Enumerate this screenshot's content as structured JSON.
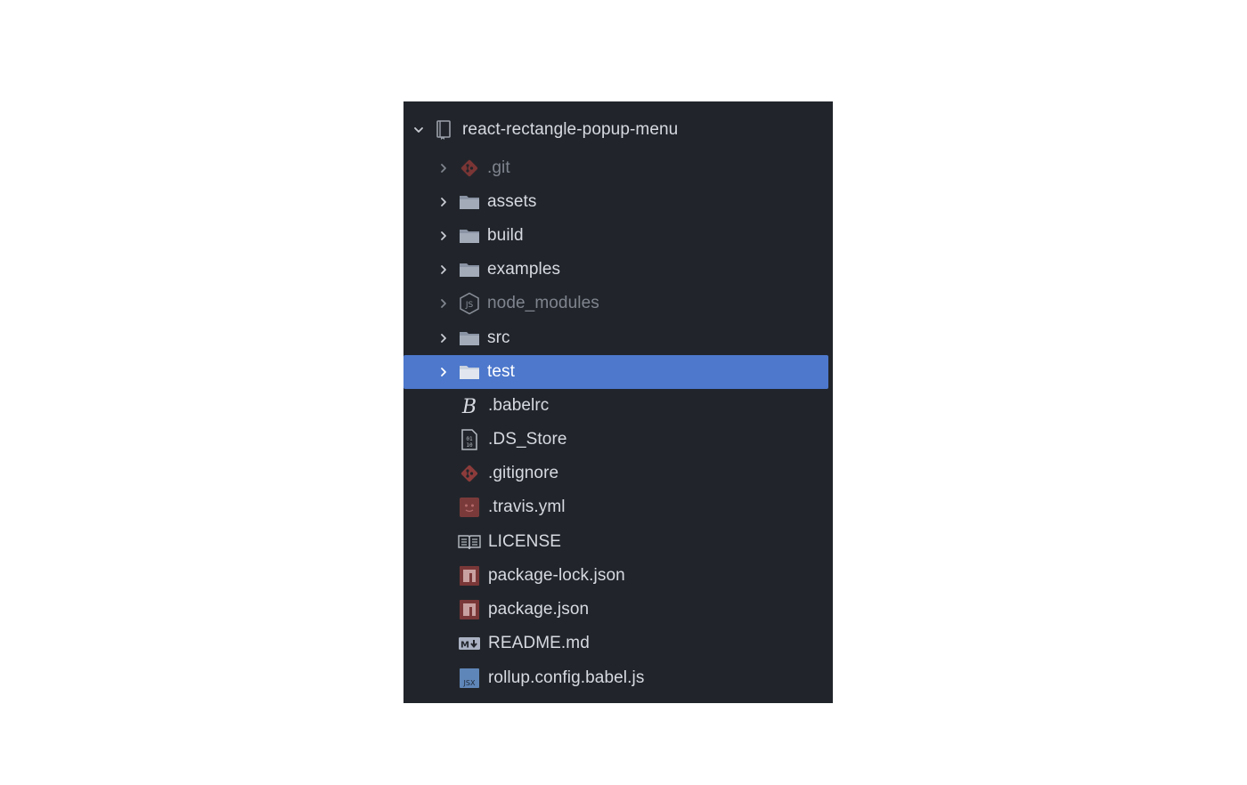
{
  "tree": {
    "root": {
      "label": "react-rectangle-popup-menu",
      "icon": "repo-icon",
      "expanded": true
    },
    "items": [
      {
        "label": ".git",
        "kind": "folder",
        "icon": "git-icon",
        "dim": true
      },
      {
        "label": "assets",
        "kind": "folder",
        "icon": "folder-icon"
      },
      {
        "label": "build",
        "kind": "folder",
        "icon": "folder-icon"
      },
      {
        "label": "examples",
        "kind": "folder",
        "icon": "folder-icon"
      },
      {
        "label": "node_modules",
        "kind": "folder",
        "icon": "nodejs-icon",
        "dim": true
      },
      {
        "label": "src",
        "kind": "folder",
        "icon": "folder-icon"
      },
      {
        "label": "test",
        "kind": "folder",
        "icon": "folder-icon",
        "selected": true
      },
      {
        "label": ".babelrc",
        "kind": "file",
        "icon": "babel-icon"
      },
      {
        "label": ".DS_Store",
        "kind": "file",
        "icon": "binary-file-icon"
      },
      {
        "label": ".gitignore",
        "kind": "file",
        "icon": "git-icon"
      },
      {
        "label": ".travis.yml",
        "kind": "file",
        "icon": "travis-icon"
      },
      {
        "label": "LICENSE",
        "kind": "file",
        "icon": "license-book-icon"
      },
      {
        "label": "package-lock.json",
        "kind": "file",
        "icon": "npm-icon"
      },
      {
        "label": "package.json",
        "kind": "file",
        "icon": "npm-icon"
      },
      {
        "label": "README.md",
        "kind": "file",
        "icon": "markdown-icon"
      },
      {
        "label": "rollup.config.babel.js",
        "kind": "file",
        "icon": "jsx-icon"
      }
    ]
  },
  "colors": {
    "panel_bg": "#21252b",
    "selection": "#4d78cc",
    "text": "#d7dae0",
    "dim_text": "#7f848e",
    "git_red": "#8c3b3b",
    "npm_red": "#7a3737",
    "folder": "#9aa3b3"
  }
}
